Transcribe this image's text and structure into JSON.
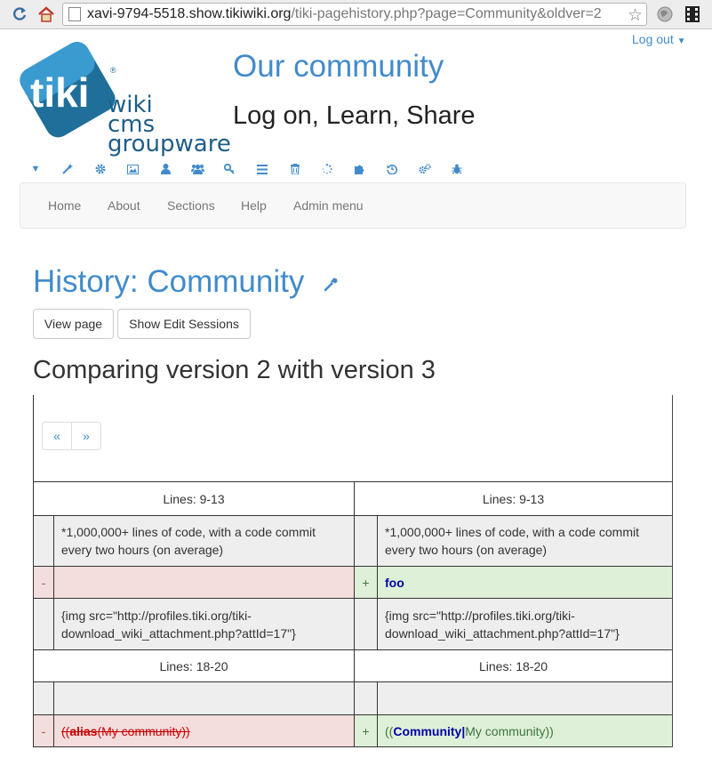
{
  "browser": {
    "url_host": "xavi-9794-5518.show.tikiwiki.org",
    "url_path": "/tiki-pagehistory.php?page=Community&oldver=2"
  },
  "header": {
    "logout_label": "Log out",
    "site_title": "Our community",
    "site_slogan": "Log on, Learn, Share",
    "logo": {
      "mark": "tiki",
      "line1": "wiki",
      "line2": "cms",
      "line3": "groupware",
      "brand_color": "#1f6f9a"
    }
  },
  "toolbar": {
    "icons": [
      "caret-down-icon",
      "magic-wand-icon",
      "gear-icon",
      "image-icon",
      "user-icon",
      "users-icon",
      "key-icon",
      "list-icon",
      "trash-icon",
      "spinner-icon",
      "puzzle-icon",
      "history-icon",
      "cogs-icon",
      "bug-icon"
    ]
  },
  "navbar": {
    "items": [
      "Home",
      "About",
      "Sections",
      "Help",
      "Admin menu"
    ]
  },
  "page": {
    "title": "History: Community",
    "buttons": {
      "view_page": "View page",
      "show_edit_sessions": "Show Edit Sessions"
    },
    "compare_heading": "Comparing version 2 with version 3"
  },
  "pager": {
    "prev": "«",
    "next": "»"
  },
  "diff": {
    "block1_header_left": "Lines: 9-13",
    "block1_header_right": "Lines: 9-13",
    "context1_left": "*1,000,000+ lines of code, with a code commit every two hours (on average)",
    "context1_right": "*1,000,000+ lines of code, with a code commit every two hours (on average)",
    "minus_sign": "-",
    "plus_sign": "+",
    "added1": "foo",
    "context2_left": "{img src=\"http://profiles.tiki.org/tiki-download_wiki_attachment.php?attId=17\"}",
    "context2_right": "{img src=\"http://profiles.tiki.org/tiki-download_wiki_attachment.php?attId=17\"}",
    "block2_header_left": "Lines: 18-20",
    "block2_header_right": "Lines: 18-20",
    "removed2": {
      "open": "((",
      "bold": "alias",
      "rest": "(My community))"
    },
    "added2": {
      "open": "((",
      "bold": "Community|",
      "rest": "My community))"
    }
  }
}
